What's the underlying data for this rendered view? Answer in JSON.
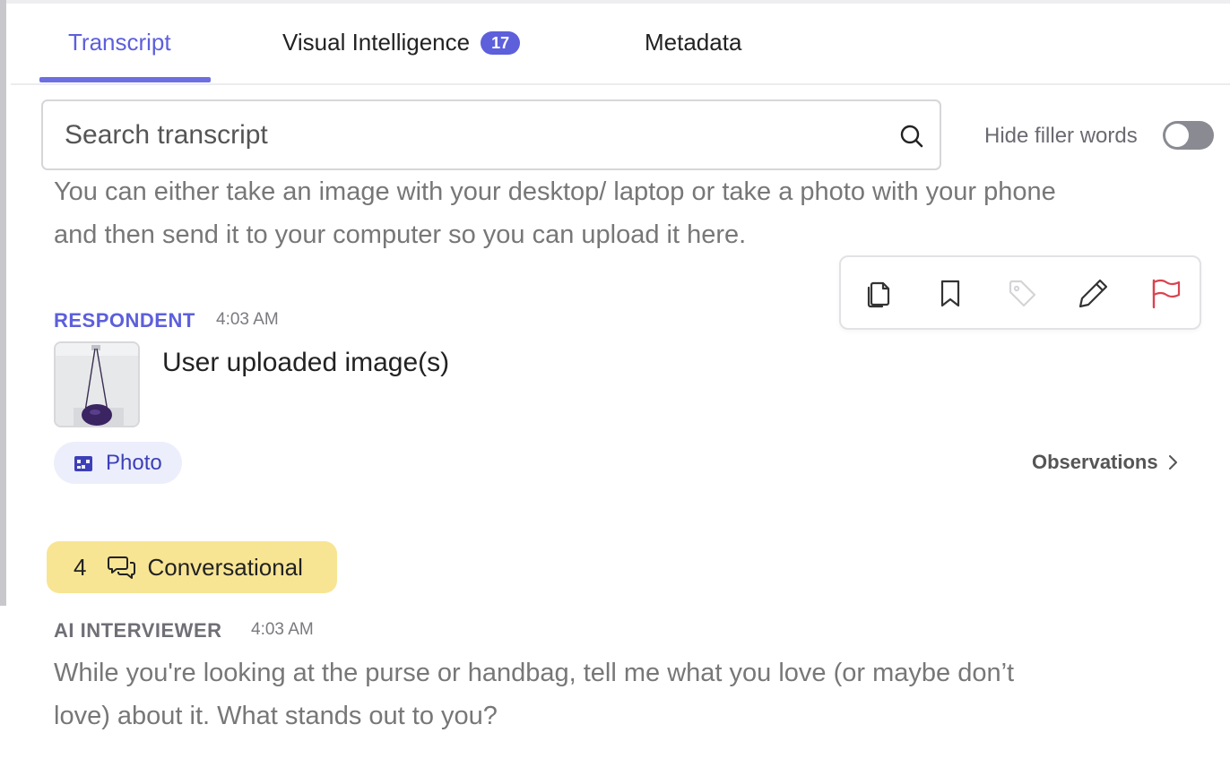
{
  "tabs": [
    {
      "label": "Transcript"
    },
    {
      "label": "Visual Intelligence",
      "badge": "17"
    },
    {
      "label": "Metadata"
    }
  ],
  "search": {
    "placeholder": "Search transcript"
  },
  "filler_toggle": {
    "label": "Hide filler words",
    "enabled": false
  },
  "previous_message": {
    "line1": "You can either take an image with your desktop/ laptop or take a photo with your phone",
    "line2": "and then send it to your computer so you can upload it here."
  },
  "toolbar": {
    "icons": [
      "copy-icon",
      "bookmark-icon",
      "tag-icon",
      "pencil-icon",
      "flag-icon"
    ],
    "flag_color": "#d9434f"
  },
  "respondent": {
    "speaker": "RESPONDENT",
    "time": "4:03 AM",
    "message": "User uploaded image(s)",
    "chip_label": "Photo",
    "observations_label": "Observations"
  },
  "section": {
    "number": "4",
    "label": "Conversational"
  },
  "ai": {
    "speaker": "AI INTERVIEWER",
    "time": "4:03 AM",
    "line1": "While you're looking at the purse or handbag, tell me what you love (or maybe don’t",
    "line2": "love) about it. What stands out to you?"
  },
  "colors": {
    "accent": "#5d5fdb",
    "section_chip": "#f8e594",
    "photo_chip": "#eceefb"
  }
}
